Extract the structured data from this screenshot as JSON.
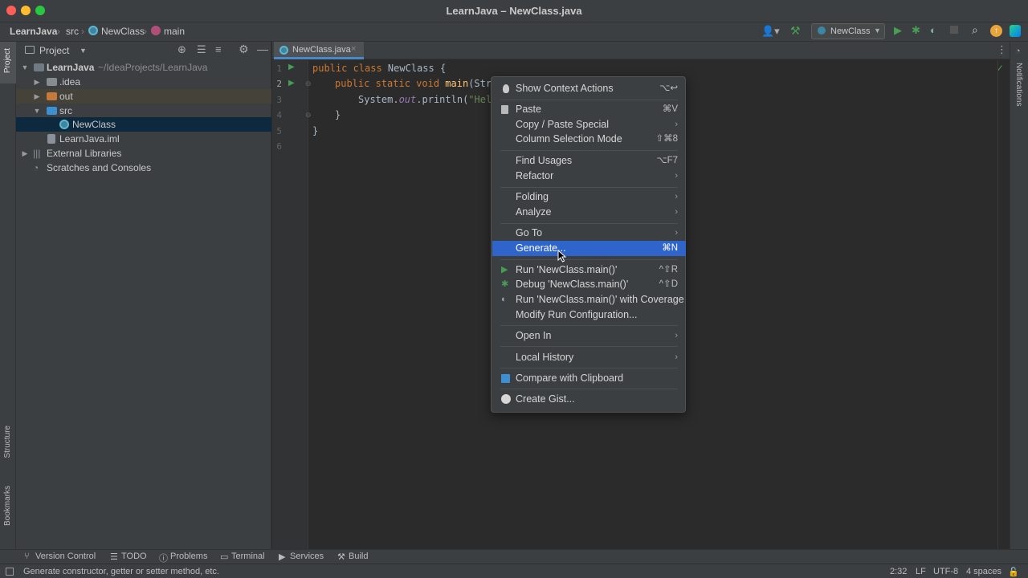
{
  "window": {
    "title": "LearnJava – NewClass.java"
  },
  "breadcrumb": {
    "project": "LearnJava",
    "folder": "src",
    "class": "NewClass",
    "method": "main"
  },
  "toolbar": {
    "run_config": "NewClass"
  },
  "left_strip": {
    "project": "Project",
    "structure": "Structure",
    "bookmarks": "Bookmarks"
  },
  "right_strip": {
    "notifications": "Notifications"
  },
  "project_panel": {
    "title": "Project",
    "tree": [
      {
        "label": "LearnJava",
        "path": "~/IdeaProjects/LearnJava"
      },
      {
        "label": ".idea"
      },
      {
        "label": "out"
      },
      {
        "label": "src"
      },
      {
        "label": "NewClass"
      },
      {
        "label": "LearnJava.iml"
      },
      {
        "label": "External Libraries"
      },
      {
        "label": "Scratches and Consoles"
      }
    ]
  },
  "editor": {
    "tab": "NewClass.java",
    "line_numbers": [
      "1",
      "2",
      "3",
      "4",
      "5",
      "6"
    ],
    "code": {
      "l1_kw": "public class",
      "l1_rest": " NewClass {",
      "l2_kw": "public static void",
      "l2_fn": "main",
      "l2_rest": "(Str",
      "l3_a": "System.",
      "l3_out": "out",
      "l3_b": ".println(",
      "l3_str": "\"Hel",
      "l4": "}",
      "l5": "}"
    }
  },
  "context_menu": {
    "items": [
      {
        "label": "Show Context Actions",
        "shortcut": "⌥↩"
      },
      {
        "label": "Paste",
        "shortcut": "⌘V"
      },
      {
        "label": "Copy / Paste Special",
        "submenu": "›"
      },
      {
        "label": "Column Selection Mode",
        "shortcut": "⇧⌘8"
      },
      {
        "label": "Find Usages",
        "shortcut": "⌥F7"
      },
      {
        "label": "Refactor",
        "submenu": "›"
      },
      {
        "label": "Folding",
        "submenu": "›"
      },
      {
        "label": "Analyze",
        "submenu": "›"
      },
      {
        "label": "Go To",
        "submenu": "›"
      },
      {
        "label": "Generate...",
        "shortcut": "⌘N"
      },
      {
        "label": "Run 'NewClass.main()'",
        "shortcut": "^⇧R"
      },
      {
        "label": "Debug 'NewClass.main()'",
        "shortcut": "^⇧D"
      },
      {
        "label": "Run 'NewClass.main()' with Coverage"
      },
      {
        "label": "Modify Run Configuration..."
      },
      {
        "label": "Open In",
        "submenu": "›"
      },
      {
        "label": "Local History",
        "submenu": "›"
      },
      {
        "label": "Compare with Clipboard"
      },
      {
        "label": "Create Gist..."
      }
    ]
  },
  "bottom_tools": {
    "version_control": "Version Control",
    "todo": "TODO",
    "problems": "Problems",
    "terminal": "Terminal",
    "services": "Services",
    "build": "Build"
  },
  "status": {
    "message": "Generate constructor, getter or setter method, etc.",
    "position": "2:32",
    "line_sep": "LF",
    "encoding": "UTF-8",
    "indent": "4 spaces"
  },
  "colors": {
    "accent": "#2f65ca",
    "run_green": "#499c54",
    "folder_blue": "#3d8fd1",
    "folder_orange": "#c7793b"
  }
}
